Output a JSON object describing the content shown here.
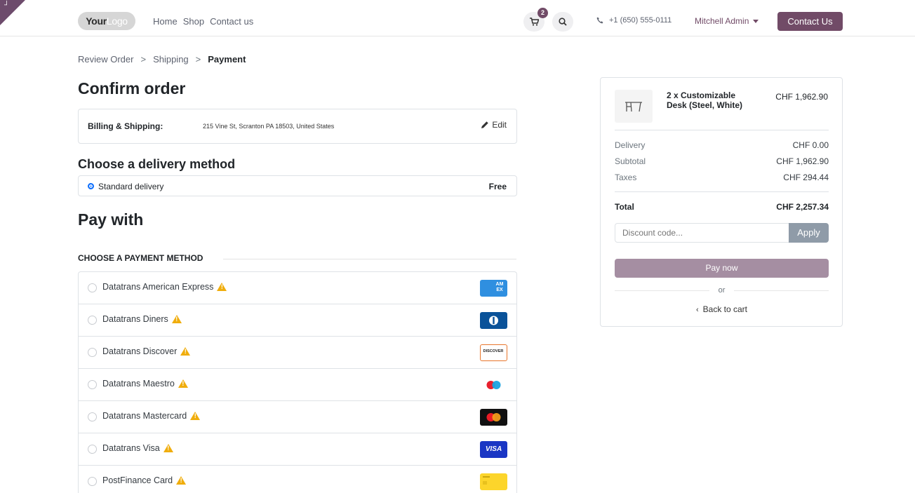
{
  "header": {
    "logo_bold": "Your",
    "logo_rest": "Logo",
    "nav": [
      "Home",
      "Shop",
      "Contact us"
    ],
    "cart_count": "2",
    "phone": "+1 (650) 555-0111",
    "user": "Mitchell Admin",
    "contact_button": "Contact Us"
  },
  "breadcrumb": {
    "step1": "Review Order",
    "step2": "Shipping",
    "step3": "Payment",
    "separator": ">"
  },
  "confirm": {
    "title": "Confirm order",
    "billing_label": "Billing & Shipping:",
    "billing_address": "215 Vine St, Scranton PA 18503, United States",
    "edit": "Edit"
  },
  "delivery": {
    "title": "Choose a delivery method",
    "method": "Standard delivery",
    "price": "Free"
  },
  "payment": {
    "title": "Pay with",
    "choose_label": "CHOOSE A PAYMENT METHOD",
    "methods": [
      {
        "name": "Datatrans American Express",
        "card": "amex-icon"
      },
      {
        "name": "Datatrans Diners",
        "card": "diners-icon"
      },
      {
        "name": "Datatrans Discover",
        "card": "discover-icon"
      },
      {
        "name": "Datatrans Maestro",
        "card": "maestro-icon"
      },
      {
        "name": "Datatrans Mastercard",
        "card": "mastercard-icon"
      },
      {
        "name": "Datatrans Visa",
        "card": "visa-icon"
      },
      {
        "name": "PostFinance Card",
        "card": "postfinance-icon"
      }
    ],
    "card_text": {
      "amex": "AM EX",
      "discover": "DISCOVER",
      "visa": "VISA"
    }
  },
  "summary": {
    "product_name": "2 x Customizable Desk (Steel, White)",
    "product_price": "CHF 1,962.90",
    "delivery_label": "Delivery",
    "delivery_value": "CHF 0.00",
    "subtotal_label": "Subtotal",
    "subtotal_value": "CHF 1,962.90",
    "taxes_label": "Taxes",
    "taxes_value": "CHF 294.44",
    "total_label": "Total",
    "total_value": "CHF 2,257.34",
    "discount_placeholder": "Discount code...",
    "apply": "Apply",
    "pay_now": "Pay now",
    "or": "or",
    "back": "Back to cart"
  },
  "colors": {
    "brand": "#714b67",
    "pay_button": "#a58ea2",
    "apply_button": "#8f9ba8",
    "warning": "#f0ad0c",
    "radio_selected": "#0d6efd"
  }
}
